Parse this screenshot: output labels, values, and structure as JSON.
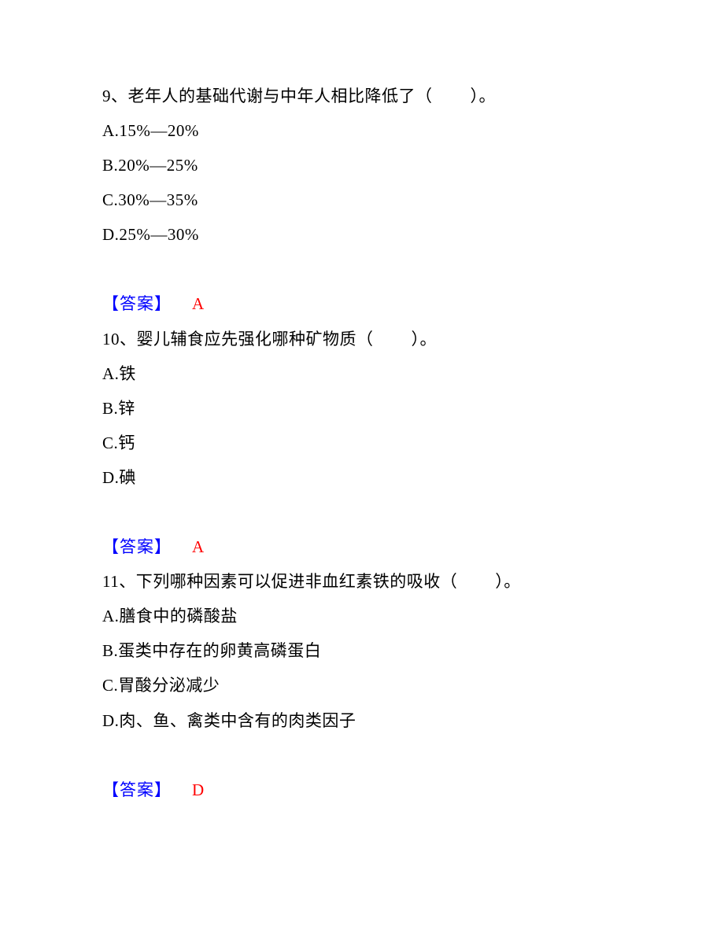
{
  "questions": [
    {
      "number": "9、",
      "stem_before": "老年人的基础代谢与中年人相比降低了（",
      "stem_after": "）。",
      "options": [
        "A.15%—20%",
        "B.20%—25%",
        "C.30%—35%",
        "D.25%—30%"
      ],
      "answer_label": "【答案】",
      "answer_value": "A"
    },
    {
      "number": "10、",
      "stem_before": "婴儿辅食应先强化哪种矿物质（",
      "stem_after": "）。",
      "options": [
        "A.铁",
        "B.锌",
        "C.钙",
        "D.碘"
      ],
      "answer_label": "【答案】",
      "answer_value": "A"
    },
    {
      "number": "11、",
      "stem_before": "下列哪种因素可以促进非血红素铁的吸收（",
      "stem_after": "）。",
      "options": [
        "A.膳食中的磷酸盐",
        "B.蛋类中存在的卵黄高磷蛋白",
        "C.胃酸分泌减少",
        "D.肉、鱼、禽类中含有的肉类因子"
      ],
      "answer_label": "【答案】",
      "answer_value": "D"
    }
  ]
}
